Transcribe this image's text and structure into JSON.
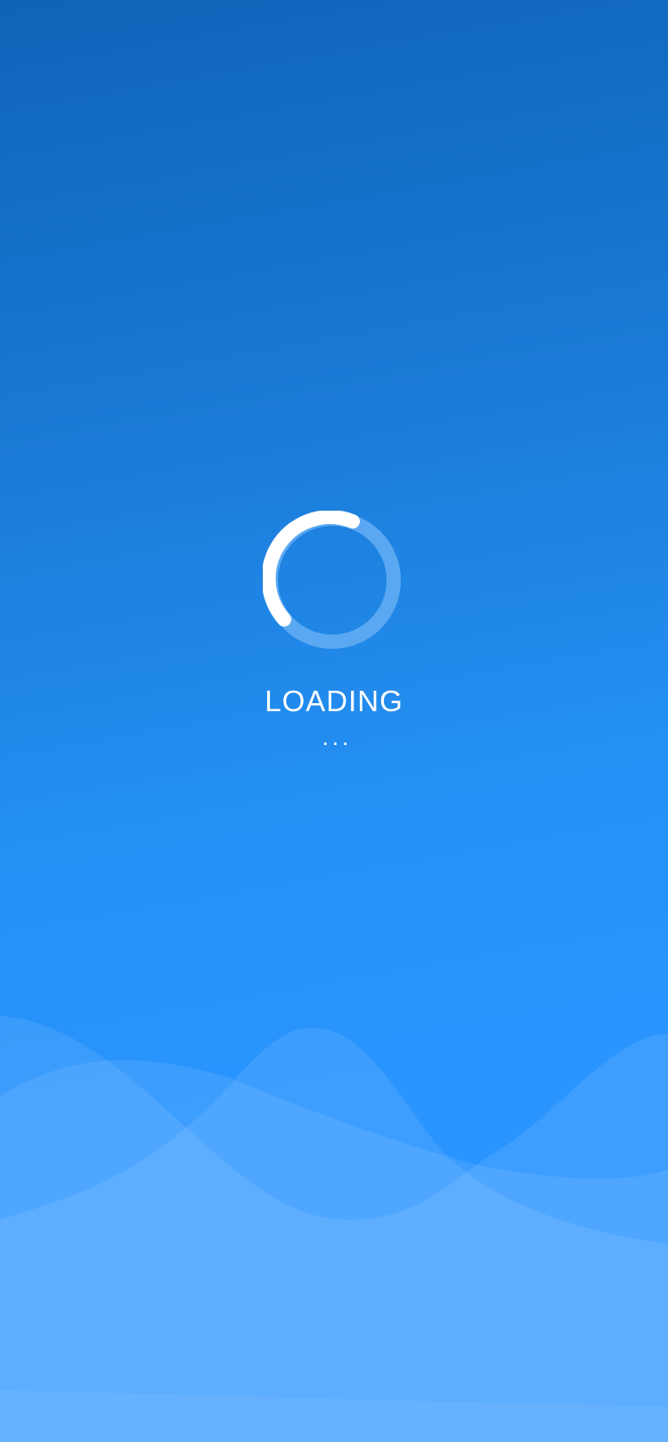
{
  "loading": {
    "label": "LOADING",
    "dots": "..."
  },
  "spinner": {
    "icon": "spinner-icon",
    "track_color": "#5aa8f2",
    "arc_color": "#ffffff"
  },
  "colors": {
    "background_top": "#0f63b8",
    "background_bottom": "#2a95ff",
    "wave_light": "#62aeff"
  }
}
